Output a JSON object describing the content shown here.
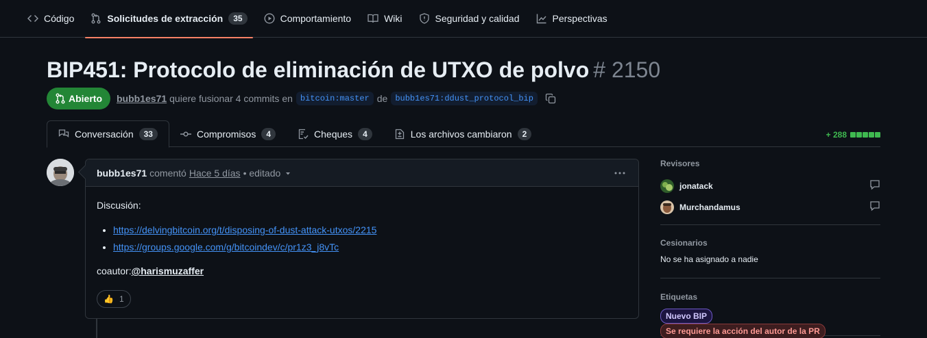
{
  "nav": {
    "items": [
      {
        "label": "Código",
        "icon": "code-icon"
      },
      {
        "label": "Solicitudes de extracción",
        "icon": "git-pull-request-icon",
        "count": "35",
        "active": true
      },
      {
        "label": "Comportamiento",
        "icon": "play-icon"
      },
      {
        "label": "Wiki",
        "icon": "book-icon"
      },
      {
        "label": "Seguridad y calidad",
        "icon": "shield-icon"
      },
      {
        "label": "Perspectivas",
        "icon": "graph-icon"
      }
    ]
  },
  "pr": {
    "title": "BIP451: Protocolo de eliminación de UTXO de polvo",
    "number": "# 2150",
    "state": "Abierto",
    "author": "bubb1es71",
    "merge_text": "quiere fusionar 4 commits en",
    "base_branch": "bitcoin:master",
    "from_text": "de",
    "head_branch": "bubb1es71:ddust_protocol_bip"
  },
  "tabs": [
    {
      "label": "Conversación",
      "count": "33",
      "icon": "comment-discussion-icon"
    },
    {
      "label": "Compromisos",
      "count": "4",
      "icon": "git-commit-icon"
    },
    {
      "label": "Cheques",
      "count": "4",
      "icon": "checklist-icon"
    },
    {
      "label": "Los archivos cambiaron",
      "count": "2",
      "icon": "file-diff-icon"
    }
  ],
  "diffstat": {
    "additions": "+ 288",
    "color": "#3fb950"
  },
  "comment": {
    "author": "bubb1es71",
    "action": "comentó",
    "time": "Hace 5 días",
    "edited": "• editado",
    "discussion_label": "Discusión:",
    "links": [
      "https://delvingbitcoin.org/t/disposing-of-dust-attack-utxos/2215",
      "https://groups.google.com/g/bitcoindev/c/pr1z3_j8vTc"
    ],
    "coauthor_label": "coautor:",
    "coauthor_mention": "@harismuzaffer",
    "reaction": {
      "emoji": "👍",
      "count": "1"
    }
  },
  "sidebar": {
    "reviewers_heading": "Revisores",
    "reviewers": [
      {
        "name": "jonatack"
      },
      {
        "name": "Murchandamus"
      }
    ],
    "assignees_heading": "Cesionarios",
    "assignees_text": "No se ha asignado a nadie",
    "labels_heading": "Etiquetas",
    "labels": [
      "Nuevo BIP",
      "Se requiere la acción del autor de la PR"
    ]
  }
}
